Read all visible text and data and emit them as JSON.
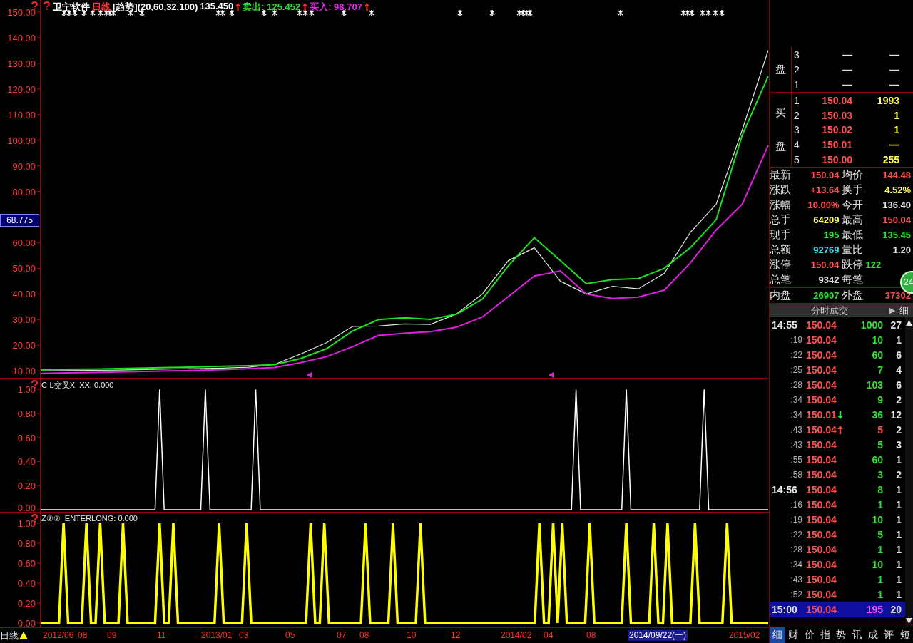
{
  "main_chart": {
    "legend": [
      {
        "text": "卫宁软件",
        "color": "#ffffff"
      },
      {
        "text": "日线",
        "color": "#ff3030"
      },
      {
        "text": "[趋势](20,60,32,100)",
        "color": "#ffffff"
      },
      {
        "text": "135.450",
        "color": "#ffffff"
      },
      {
        "kind": "arrow",
        "color": "#ff3030"
      },
      {
        "text": "卖出: 125.452",
        "color": "#30e030"
      },
      {
        "kind": "arrow",
        "color": "#ff3030"
      },
      {
        "text": "买入: 98.707",
        "color": "#e030e0"
      },
      {
        "kind": "arrow",
        "color": "#ff3030"
      }
    ],
    "cursor_value": "68.775",
    "chart_data": {
      "type": "line",
      "ylim": [
        7,
        154.7
      ],
      "yticks": [
        {
          "value": 150,
          "label": "150.00"
        },
        {
          "value": 140,
          "label": "140.00"
        },
        {
          "value": 130,
          "label": "130.00"
        },
        {
          "value": 120,
          "label": "120.00"
        },
        {
          "value": 110,
          "label": "110.00"
        },
        {
          "value": 100,
          "label": "100.00"
        },
        {
          "value": 90,
          "label": "90.00"
        },
        {
          "value": 80,
          "label": "80.00"
        },
        {
          "value": 60,
          "label": "60.00"
        },
        {
          "value": 50,
          "label": "50.00"
        },
        {
          "value": 40,
          "label": "40.00"
        },
        {
          "value": 30,
          "label": "30.00"
        },
        {
          "value": 20,
          "label": "20.00"
        },
        {
          "value": 10,
          "label": "10.00"
        }
      ],
      "categories": [
        null,
        null,
        null,
        null,
        null,
        null,
        null,
        null,
        null,
        null,
        null,
        null,
        null,
        null,
        null,
        null,
        null,
        null,
        null,
        null,
        null,
        null,
        null,
        null,
        null,
        null,
        null,
        null,
        null
      ],
      "series": [
        {
          "color": "#d8f0d8",
          "values": [
            10,
            10.1,
            10.2,
            10.3,
            10.5,
            10.7,
            10.9,
            11.1,
            11.4,
            12.5,
            16.5,
            21,
            27.3,
            27.5,
            28.3,
            28.1,
            32.2,
            40,
            53,
            58,
            45,
            40,
            43,
            42,
            48,
            64,
            75,
            104,
            135
          ]
        },
        {
          "color": "#20e020",
          "values": [
            10.5,
            10.6,
            10.7,
            10.9,
            11.1,
            11.3,
            11.5,
            11.8,
            12,
            12.4,
            14.8,
            18.6,
            25.5,
            30,
            30.7,
            30.1,
            32.1,
            38,
            51,
            62,
            53,
            44,
            45.6,
            46,
            50,
            58,
            69,
            102,
            125
          ]
        },
        {
          "color": "#e020e0",
          "values": [
            9,
            9.2,
            9.4,
            9.6,
            9.8,
            10,
            10.2,
            10.5,
            10.8,
            11.3,
            13.2,
            15.5,
            19.4,
            23.8,
            24.7,
            25.3,
            27,
            31,
            39,
            47,
            49,
            40,
            38.2,
            38.8,
            41.5,
            52,
            65,
            75,
            98
          ]
        }
      ]
    }
  },
  "indicator_1": {
    "legend": "C-L交叉X  XX: 0.000",
    "chart_data": {
      "type": "line",
      "ylim": [
        0,
        1.09
      ],
      "yticks": [
        {
          "value": 1,
          "label": "1.00"
        },
        {
          "value": 0.8,
          "label": "0.80"
        },
        {
          "value": 0.6,
          "label": "0.60"
        },
        {
          "value": 0.4,
          "label": "0.40"
        },
        {
          "value": 0.2,
          "label": "0.20"
        },
        {
          "value": 0,
          "label": "0.00"
        }
      ],
      "categories": [
        null,
        null,
        null,
        null,
        null,
        null,
        null,
        null,
        null,
        null,
        null,
        null,
        null,
        null,
        null,
        null,
        null,
        null,
        null,
        null,
        null,
        null,
        null,
        null,
        null,
        null,
        null,
        null,
        null,
        null,
        null,
        null,
        null,
        null,
        null,
        null,
        null,
        null,
        null,
        null,
        null,
        null,
        null,
        null,
        null,
        null,
        null,
        null,
        null,
        null,
        null,
        null,
        null,
        null,
        null,
        null,
        null,
        null,
        null,
        null,
        null,
        null,
        null,
        null,
        null,
        null,
        null,
        null,
        null,
        null,
        null,
        null,
        null,
        null,
        null,
        null,
        null,
        null,
        null,
        null,
        null,
        null,
        null,
        null,
        null,
        null,
        null,
        null,
        null,
        null,
        null,
        null,
        null,
        null,
        null,
        null,
        null,
        null,
        null,
        null,
        null,
        null,
        null,
        null,
        null,
        null,
        null,
        null,
        null,
        null,
        null,
        null,
        null,
        null,
        null,
        null,
        null,
        null,
        null,
        null,
        null,
        null,
        null,
        null,
        null,
        null,
        null,
        null,
        null,
        null,
        null,
        null,
        null,
        null,
        null,
        null,
        null,
        null,
        null,
        null,
        null,
        null,
        null,
        null,
        null,
        null,
        null,
        null,
        null,
        null,
        null,
        null,
        null,
        null,
        null,
        null,
        null,
        null,
        null,
        null
      ],
      "series": [
        {
          "color": "#ffffff",
          "values": [
            0,
            0,
            0,
            0,
            0,
            0,
            0,
            0,
            0,
            0,
            0,
            0,
            0,
            0,
            0,
            0,
            0,
            0,
            0,
            0,
            0,
            0,
            0,
            0,
            0,
            0,
            1,
            0,
            0,
            0,
            0,
            0,
            0,
            0,
            0,
            0,
            1,
            0,
            0,
            0,
            0,
            0,
            0,
            0,
            0,
            0,
            0,
            1,
            0,
            0,
            0,
            0,
            0,
            0,
            0,
            0,
            0,
            0,
            0,
            0,
            0,
            0,
            0,
            0,
            0,
            0,
            0,
            0,
            0,
            0,
            0,
            0,
            0,
            0,
            0,
            0,
            0,
            0,
            0,
            0,
            0,
            0,
            0,
            0,
            0,
            0,
            0,
            0,
            0,
            0,
            0,
            0,
            0,
            0,
            0,
            0,
            0,
            0,
            0,
            0,
            0,
            0,
            0,
            0,
            0,
            0,
            0,
            0,
            0,
            0,
            0,
            0,
            0,
            0,
            0,
            0,
            0,
            1,
            0,
            0,
            0,
            0,
            0,
            0,
            0,
            0,
            0,
            0,
            1,
            0,
            0,
            0,
            0,
            0,
            0,
            0,
            0,
            0,
            0,
            0,
            0,
            0,
            0,
            0,
            0,
            1,
            0,
            0,
            0,
            0,
            0,
            0,
            0,
            0,
            0,
            0,
            0,
            0,
            0,
            0
          ]
        }
      ]
    }
  },
  "indicator_2": {
    "legend": "Z②②  ENTERLONG: 0.000",
    "chart_data": {
      "type": "line",
      "ylim": [
        -0.05,
        1.107
      ],
      "yticks": [
        {
          "value": 1,
          "label": "1.00"
        },
        {
          "value": 0.8,
          "label": "0.80"
        },
        {
          "value": 0.6,
          "label": "0.60"
        },
        {
          "value": 0.4,
          "label": "0.40"
        },
        {
          "value": 0.2,
          "label": "0.20"
        },
        {
          "value": 0,
          "label": "0.00"
        }
      ],
      "categories": [
        null,
        null,
        null,
        null,
        null,
        null,
        null,
        null,
        null,
        null,
        null,
        null,
        null,
        null,
        null,
        null,
        null,
        null,
        null,
        null,
        null,
        null,
        null,
        null,
        null,
        null,
        null,
        null,
        null,
        null,
        null,
        null,
        null,
        null,
        null,
        null,
        null,
        null,
        null,
        null,
        null,
        null,
        null,
        null,
        null,
        null,
        null,
        null,
        null,
        null,
        null,
        null,
        null,
        null,
        null,
        null,
        null,
        null,
        null,
        null,
        null,
        null,
        null,
        null,
        null,
        null,
        null,
        null,
        null,
        null,
        null,
        null,
        null,
        null,
        null,
        null,
        null,
        null,
        null,
        null,
        null,
        null,
        null,
        null,
        null,
        null,
        null,
        null,
        null,
        null,
        null,
        null,
        null,
        null,
        null,
        null,
        null,
        null,
        null,
        null,
        null,
        null,
        null,
        null,
        null,
        null,
        null,
        null,
        null,
        null,
        null,
        null,
        null,
        null,
        null,
        null,
        null,
        null,
        null,
        null,
        null,
        null,
        null,
        null,
        null,
        null,
        null,
        null,
        null,
        null,
        null,
        null,
        null,
        null,
        null,
        null,
        null,
        null,
        null,
        null,
        null,
        null,
        null,
        null,
        null,
        null,
        null,
        null,
        null,
        null,
        null,
        null,
        null,
        null,
        null,
        null,
        null,
        null,
        null,
        null
      ],
      "series": [
        {
          "color": "#ffff00",
          "values": [
            0,
            0,
            0,
            0,
            0,
            1,
            0,
            0,
            0,
            0,
            1,
            0,
            0,
            1,
            0,
            0,
            0,
            0,
            1,
            0,
            0,
            0,
            0,
            0,
            0,
            0,
            1,
            0,
            0,
            1,
            0,
            0,
            0,
            0,
            0,
            0,
            0,
            0,
            0,
            1,
            0,
            0,
            0,
            0,
            0,
            1,
            0,
            0,
            0,
            0,
            0,
            0,
            0,
            0,
            0,
            0,
            0,
            0,
            0,
            1,
            0,
            0,
            1,
            0,
            0,
            0,
            0,
            0,
            0,
            0,
            0,
            1,
            0,
            0,
            0,
            0,
            0,
            1,
            0,
            0,
            0,
            0,
            0,
            1,
            0,
            0,
            0,
            0,
            0,
            0,
            0,
            0,
            0,
            0,
            0,
            0,
            0,
            0,
            0,
            0,
            0,
            0,
            0,
            0,
            0,
            0,
            0,
            0,
            0,
            1,
            0,
            0,
            1,
            0,
            1,
            0,
            0,
            0,
            0,
            0,
            1,
            0,
            0,
            0,
            0,
            0,
            0,
            0,
            1,
            0,
            0,
            0,
            0,
            0,
            1,
            0,
            0,
            1,
            0,
            0,
            0,
            0,
            0,
            1,
            0,
            0,
            0,
            0,
            0,
            0,
            1,
            0,
            0,
            0,
            0,
            0,
            0,
            0,
            0,
            0
          ]
        }
      ]
    }
  },
  "time_axis": {
    "period": "日线",
    "labels": [
      {
        "text": "2012/06",
        "selected": false
      },
      {
        "text": "08",
        "selected": false
      },
      {
        "text": "09",
        "selected": false
      },
      {
        "text": "11",
        "selected": false
      },
      {
        "text": "2013/01",
        "selected": false
      },
      {
        "text": "03",
        "selected": false
      },
      {
        "text": "05",
        "selected": false
      },
      {
        "text": "07",
        "selected": false
      },
      {
        "text": "08",
        "selected": false
      },
      {
        "text": "10",
        "selected": false
      },
      {
        "text": "12",
        "selected": false
      },
      {
        "text": "2014/02",
        "selected": false
      },
      {
        "text": "04",
        "selected": false
      },
      {
        "text": "08",
        "selected": false
      },
      {
        "text": "2014/09/22(一)",
        "selected": true
      },
      {
        "text": "2015/02",
        "selected": false
      }
    ]
  },
  "quote_panel": {
    "sell_label": "盘",
    "sell_rows": [
      {
        "rank": "3",
        "price": "—",
        "volume": "—"
      },
      {
        "rank": "2",
        "price": "—",
        "volume": "—"
      },
      {
        "rank": "1",
        "price": "—",
        "volume": "—"
      }
    ],
    "buy_label": [
      "买",
      "盘"
    ],
    "buy_rows": [
      {
        "rank": "1",
        "price": "150.04",
        "volume": "1993"
      },
      {
        "rank": "2",
        "price": "150.03",
        "volume": "1"
      },
      {
        "rank": "3",
        "price": "150.02",
        "volume": "1"
      },
      {
        "rank": "4",
        "price": "150.01",
        "volume": "—"
      },
      {
        "rank": "5",
        "price": "150.00",
        "volume": "255"
      }
    ],
    "stats": [
      {
        "label": "最新",
        "value": "150.04",
        "color": "#ff5050"
      },
      {
        "label": "均价",
        "value": "144.48",
        "color": "#ff5050"
      },
      {
        "label": "涨跌",
        "value": "+13.64",
        "color": "#ff5050"
      },
      {
        "label": "换手",
        "value": "4.52%",
        "color": "#ffff50"
      },
      {
        "label": "涨幅",
        "value": "10.00%",
        "color": "#ff5050"
      },
      {
        "label": "今开",
        "value": "136.40",
        "color": "#e0e0e0"
      },
      {
        "label": "总手",
        "value": "64209",
        "color": "#ffff50"
      },
      {
        "label": "最高",
        "value": "150.04",
        "color": "#ff5050"
      },
      {
        "label": "现手",
        "value": "195",
        "color": "#30e030"
      },
      {
        "label": "最低",
        "value": "135.45",
        "color": "#30e030"
      },
      {
        "label": "总额",
        "value": "92769",
        "color": "#40e0f0"
      },
      {
        "label": "量比",
        "value": "1.20",
        "color": "#e0e0e0"
      },
      {
        "label": "涨停",
        "value": "150.04",
        "color": "#ff5050"
      },
      {
        "label": "跌停",
        "value": "122",
        "color": "#30e030"
      },
      {
        "label": "总笔",
        "value": "9342",
        "color": "#e0e0e0"
      },
      {
        "label": "每笔"
      }
    ],
    "volume_split": [
      {
        "label": "内盘",
        "value": "26907",
        "color": "#30e030"
      },
      {
        "label": "外盘",
        "value": "37302",
        "color": "#ff5050"
      }
    ],
    "float_badge": "24",
    "ticks_header": {
      "title": "分时成交",
      "button_arrow": "▶",
      "button": "细"
    },
    "ticks": [
      {
        "time": "14:55",
        "price": "150.04",
        "volume": "1000",
        "color": "#30e030",
        "count": "27",
        "selected": false
      },
      {
        "time": ":19",
        "price": "150.04",
        "volume": "10",
        "color": "#30e030",
        "count": "1",
        "selected": false
      },
      {
        "time": ":22",
        "price": "150.04",
        "volume": "60",
        "color": "#30e030",
        "count": "6",
        "selected": false
      },
      {
        "time": ":25",
        "price": "150.04",
        "volume": "7",
        "color": "#30e030",
        "count": "4",
        "selected": false
      },
      {
        "time": ":28",
        "price": "150.04",
        "volume": "103",
        "color": "#30e030",
        "count": "6",
        "selected": false
      },
      {
        "time": ":34",
        "price": "150.04",
        "volume": "9",
        "color": "#30e030",
        "count": "2",
        "selected": false
      },
      {
        "time": ":34",
        "price": "150.01",
        "arrow": {
          "kind": "down",
          "color": "#30e030"
        },
        "volume": "36",
        "color": "#30e030",
        "count": "12",
        "selected": false
      },
      {
        "time": ":43",
        "price": "150.04",
        "arrow": {
          "kind": "up",
          "color": "#ff4040"
        },
        "volume": "5",
        "color": "#ff5050",
        "count": "2",
        "selected": false
      },
      {
        "time": ":43",
        "price": "150.04",
        "volume": "5",
        "color": "#30e030",
        "count": "3",
        "selected": false
      },
      {
        "time": ":55",
        "price": "150.04",
        "volume": "60",
        "color": "#30e030",
        "count": "1",
        "selected": false
      },
      {
        "time": ":58",
        "price": "150.04",
        "volume": "3",
        "color": "#30e030",
        "count": "2",
        "selected": false
      },
      {
        "time": "14:56",
        "price": "150.04",
        "volume": "8",
        "color": "#30e030",
        "count": "1",
        "selected": false
      },
      {
        "time": ":16",
        "price": "150.04",
        "volume": "1",
        "color": "#30e030",
        "count": "1",
        "selected": false
      },
      {
        "time": ":19",
        "price": "150.04",
        "volume": "10",
        "color": "#30e030",
        "count": "1",
        "selected": false
      },
      {
        "time": ":22",
        "price": "150.04",
        "volume": "5",
        "color": "#30e030",
        "count": "1",
        "selected": false
      },
      {
        "time": ":28",
        "price": "150.04",
        "volume": "1",
        "color": "#30e030",
        "count": "1",
        "selected": false
      },
      {
        "time": ":34",
        "price": "150.04",
        "volume": "10",
        "color": "#30e030",
        "count": "1",
        "selected": false
      },
      {
        "time": ":43",
        "price": "150.04",
        "volume": "1",
        "color": "#30e030",
        "count": "1",
        "selected": false
      },
      {
        "time": ":52",
        "price": "150.04",
        "volume": "1",
        "color": "#30e030",
        "count": "1",
        "selected": false
      },
      {
        "time": "15:00",
        "price": "150.04",
        "volume": "195",
        "color": "#ff50ff",
        "count": "20",
        "selected": true
      }
    ],
    "bottom_tabs": [
      {
        "label": "细",
        "selected": true
      },
      {
        "label": "财",
        "selected": false
      },
      {
        "label": "价",
        "selected": false
      },
      {
        "label": "指",
        "selected": false
      },
      {
        "label": "势",
        "selected": false
      },
      {
        "label": "讯",
        "selected": false
      },
      {
        "label": "成",
        "selected": false
      },
      {
        "label": "评",
        "selected": false
      },
      {
        "label": "短",
        "selected": false
      }
    ]
  }
}
